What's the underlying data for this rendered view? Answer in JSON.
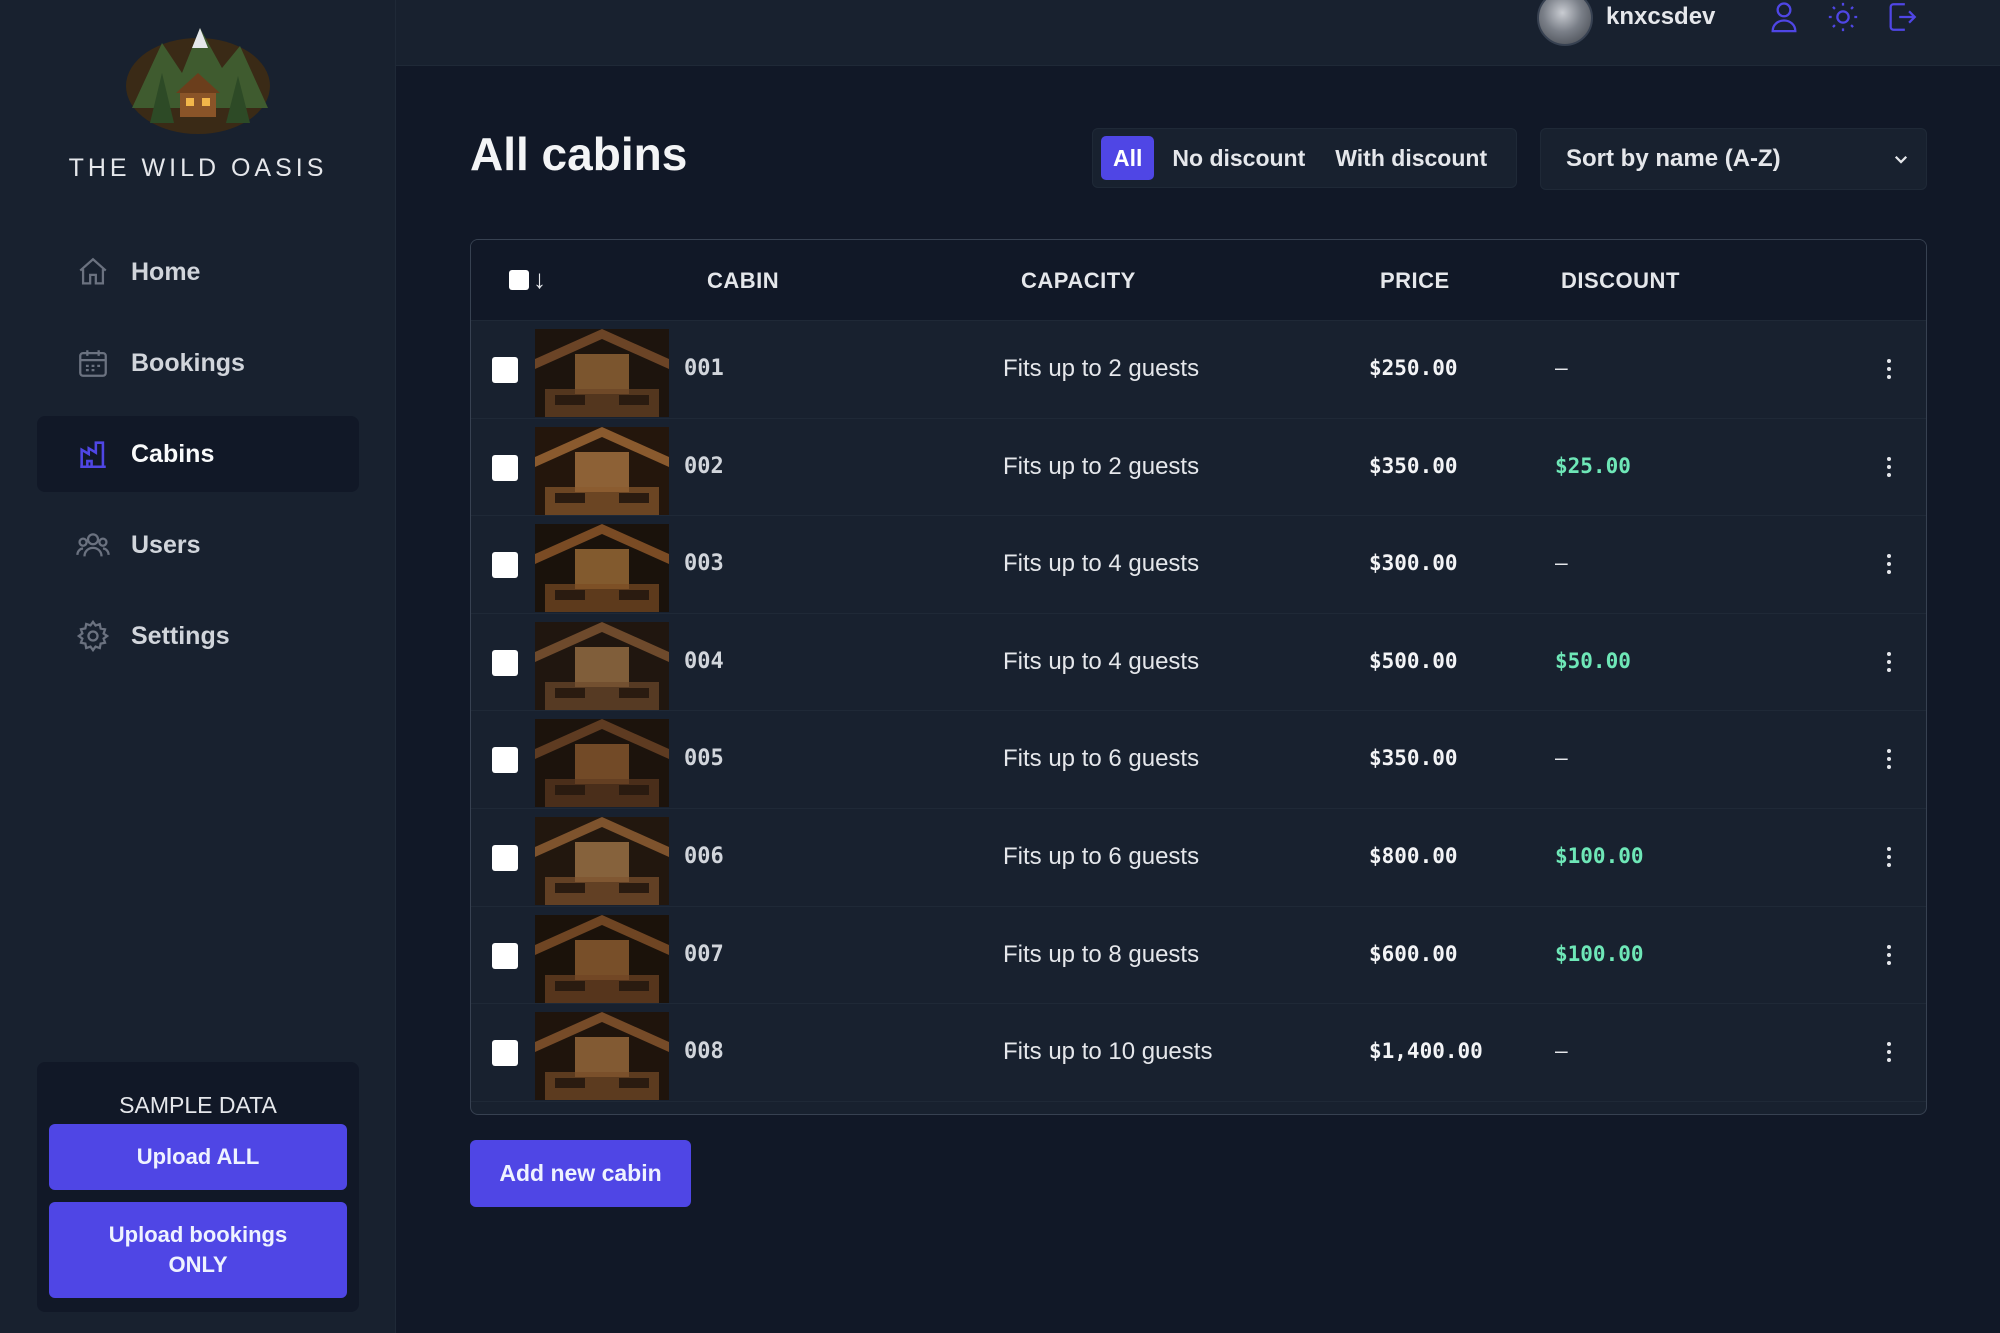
{
  "brand": {
    "name": "THE WILD OASIS"
  },
  "header": {
    "username": "knxcsdev",
    "icons": [
      "user-icon",
      "sun-icon",
      "logout-icon"
    ]
  },
  "sidebar": {
    "items": [
      {
        "label": "Home",
        "icon": "home-icon",
        "active": false
      },
      {
        "label": "Bookings",
        "icon": "calendar-icon",
        "active": false
      },
      {
        "label": "Cabins",
        "icon": "cabins-icon",
        "active": true
      },
      {
        "label": "Users",
        "icon": "users-icon",
        "active": false
      },
      {
        "label": "Settings",
        "icon": "gear-icon",
        "active": false
      }
    ],
    "sample": {
      "title": "SAMPLE DATA",
      "upload_all": "Upload ALL",
      "upload_bookings_line1": "Upload bookings",
      "upload_bookings_line2": "ONLY"
    }
  },
  "main": {
    "title": "All cabins",
    "filters": {
      "all": "All",
      "no_discount": "No discount",
      "with_discount": "With discount",
      "active": "All"
    },
    "sort": {
      "selected": "Sort by name (A-Z)"
    },
    "table": {
      "headers": {
        "cabin": "CABIN",
        "capacity": "CAPACITY",
        "price": "PRICE",
        "discount": "DISCOUNT"
      },
      "rows": [
        {
          "name": "001",
          "capacity": "Fits up to 2 guests",
          "price": "$250.00",
          "discount": "–"
        },
        {
          "name": "002",
          "capacity": "Fits up to 2 guests",
          "price": "$350.00",
          "discount": "$25.00"
        },
        {
          "name": "003",
          "capacity": "Fits up to 4 guests",
          "price": "$300.00",
          "discount": "–"
        },
        {
          "name": "004",
          "capacity": "Fits up to 4 guests",
          "price": "$500.00",
          "discount": "$50.00"
        },
        {
          "name": "005",
          "capacity": "Fits up to 6 guests",
          "price": "$350.00",
          "discount": "–"
        },
        {
          "name": "006",
          "capacity": "Fits up to 6 guests",
          "price": "$800.00",
          "discount": "$100.00"
        },
        {
          "name": "007",
          "capacity": "Fits up to 8 guests",
          "price": "$600.00",
          "discount": "$100.00"
        },
        {
          "name": "008",
          "capacity": "Fits up to 10 guests",
          "price": "$1,400.00",
          "discount": "–"
        }
      ]
    },
    "add_button": "Add new cabin"
  },
  "colors": {
    "accent": "#4f46e5",
    "background": "#111827",
    "panel": "#18212f",
    "discount": "#6ee7b7"
  }
}
